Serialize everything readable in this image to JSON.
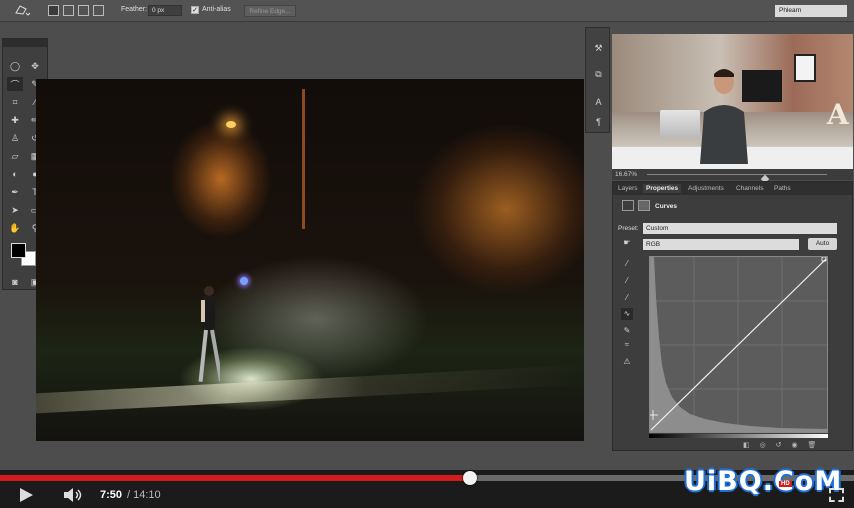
{
  "options_bar": {
    "feather_label": "Feather:",
    "feather_value": "0 px",
    "antialias_label": "Anti-alias",
    "antialias_checked": true,
    "refine_edge_label": "Refine Edge...",
    "workspace_label": "Phlearn"
  },
  "video_inset": {
    "zoom": "16.67%",
    "letter": "A"
  },
  "properties": {
    "tabs": [
      {
        "label": "Layers",
        "active": false
      },
      {
        "label": "Properties",
        "active": true
      },
      {
        "label": "Adjustments",
        "active": false
      },
      {
        "label": "Channels",
        "active": false
      },
      {
        "label": "Paths",
        "active": false
      }
    ],
    "panel_title": "Curves",
    "preset_label": "Preset:",
    "preset_value": "Custom",
    "channel_value": "RGB",
    "auto_label": "Auto"
  },
  "player": {
    "current_time": "7:50",
    "separator_total": "/ 14:10",
    "progress": 0.55,
    "hd_label": "HD"
  },
  "watermark": "UiBQ.CoM",
  "colors": {
    "progress_red": "#d41b1b",
    "watermark_blue": "#1e6fd8"
  }
}
